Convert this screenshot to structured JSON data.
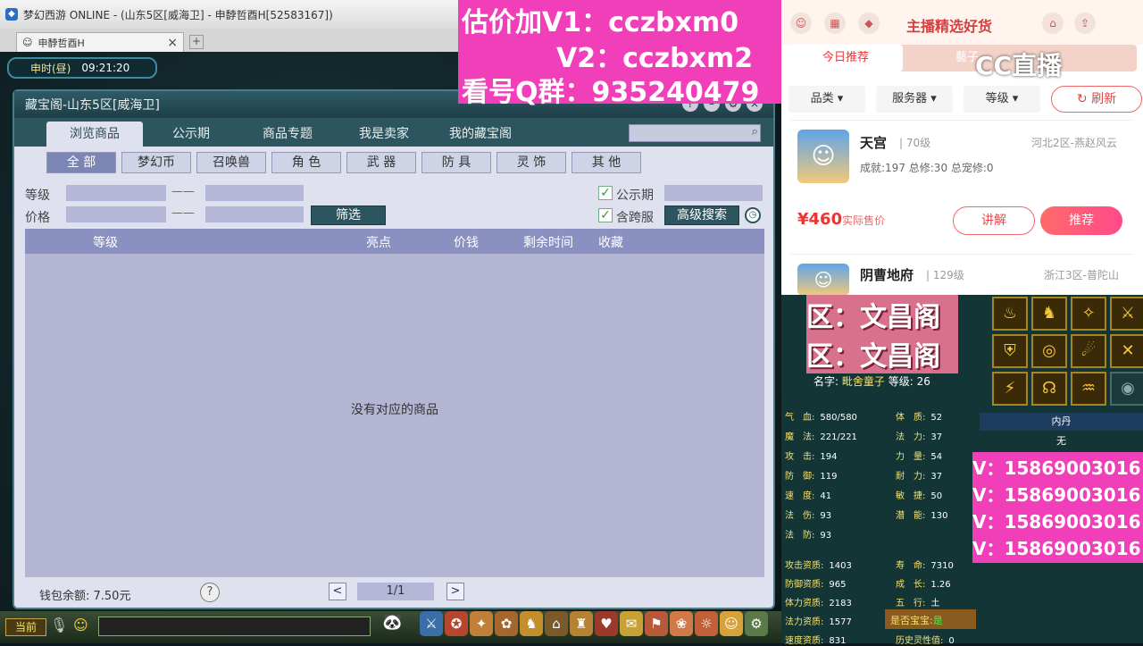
{
  "window": {
    "title": "梦幻西游 ONLINE - (山东5区[威海卫] - 申馞哲酉H[52583167])",
    "tab_label": "申馞哲酉H",
    "tab_close": "×",
    "new_tab": "+"
  },
  "clock": {
    "period": "申时(昼)",
    "time": "09:21:20"
  },
  "dialog": {
    "title": "藏宝阁-山东5区[威海卫]",
    "tabs": [
      "浏览商品",
      "公示期",
      "商品专题",
      "我是卖家",
      "我的藏宝阁"
    ],
    "active_tab": 0,
    "categories": [
      "全 部",
      "梦幻币",
      "召唤兽",
      "角 色",
      "武 器",
      "防 具",
      "灵 饰",
      "其 他"
    ],
    "active_category": 0,
    "filters": {
      "level_label": "等级",
      "price_label": "价格",
      "dash": "——",
      "filter_button": "筛选",
      "public_label": "公示期",
      "cross_label": "含跨服",
      "advanced_button": "高级搜索",
      "public_checked": true,
      "cross_checked": true
    },
    "table_headers": [
      "等级",
      "亮点",
      "价钱",
      "剩余时间",
      "收藏"
    ],
    "empty_message": "没有对应的商品",
    "footer": {
      "wallet": "钱包余额: 7.50元",
      "help": "?",
      "page": "1/1",
      "prev": "<",
      "next": ">"
    }
  },
  "bottom_bar": {
    "now_button": "当前"
  },
  "overlay_ad": {
    "line1": "估价加V1：cczbxm0",
    "line2": "V2：cczbxm2",
    "line3": "看号Q群：935240479"
  },
  "shop": {
    "title": "主播精选好货",
    "tabs": [
      "今日推荐",
      "藝子"
    ],
    "filters": [
      "品类",
      "服务器",
      "等级"
    ],
    "refresh": "刷新",
    "watermark": "CC直播",
    "items": [
      {
        "name": "天宫",
        "level": "70级",
        "server": "河北2区-燕赵风云",
        "stats": "成就:197 总修:30 总宠修:0",
        "price": "¥460",
        "price_label": "实际售价",
        "explain": "讲解",
        "recommend": "推荐"
      },
      {
        "name": "阴曹地府",
        "level": "129级",
        "server": "浙江3区-普陀山"
      }
    ]
  },
  "pet_panel": {
    "zone_line1": "区：文昌阁",
    "zone_line2": "区：文昌阁",
    "name_label": "名字:",
    "name_value": "毗舍童子",
    "level_label": "等级:",
    "level_value": "26",
    "stats_left": [
      {
        "label": "气　血:",
        "value": "580/580"
      },
      {
        "label": "魔　法:",
        "value": "221/221"
      },
      {
        "label": "攻　击:",
        "value": "194"
      },
      {
        "label": "防　御:",
        "value": "119"
      },
      {
        "label": "速　度:",
        "value": "41"
      },
      {
        "label": "法　伤:",
        "value": "93"
      },
      {
        "label": "法　防:",
        "value": "93"
      }
    ],
    "stats_right": [
      {
        "label": "体　质:",
        "value": "52"
      },
      {
        "label": "法　力:",
        "value": "37"
      },
      {
        "label": "力　量:",
        "value": "54"
      },
      {
        "label": "耐　力:",
        "value": "37"
      },
      {
        "label": "敏　捷:",
        "value": "50"
      },
      {
        "label": "潜　能:",
        "value": "130"
      }
    ],
    "aptitude_left": [
      {
        "label": "攻击资质:",
        "value": "1403"
      },
      {
        "label": "防御资质:",
        "value": "965"
      },
      {
        "label": "体力资质:",
        "value": "2183"
      },
      {
        "label": "法力资质:",
        "value": "1577"
      },
      {
        "label": "速度资质:",
        "value": "831"
      }
    ],
    "aptitude_right": [
      {
        "label": "寿　命:",
        "value": "7310"
      },
      {
        "label": "成　长:",
        "value": "1.26"
      },
      {
        "label": "五　行:",
        "value": "土"
      }
    ],
    "is_baobao_label": "是否宝宝:",
    "is_baobao_value": "是",
    "history_label": "历史灵性值:",
    "history_value": "0",
    "neidan_label": "内丹",
    "neidan_value": "无",
    "phone": "V：15869003016"
  }
}
